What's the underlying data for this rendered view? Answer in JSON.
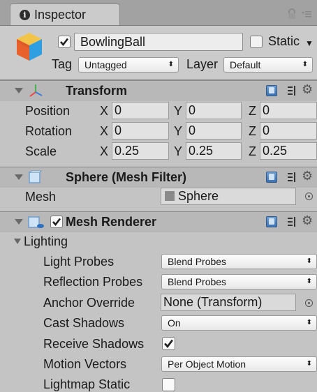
{
  "tab": {
    "title": "Inspector"
  },
  "header": {
    "object_name": "BowlingBall",
    "static_label": "Static",
    "tag_label": "Tag",
    "tag_value": "Untagged",
    "layer_label": "Layer",
    "layer_value": "Default"
  },
  "transform": {
    "title": "Transform",
    "rows": [
      {
        "label": "Position",
        "x": "0",
        "y": "0",
        "z": "0"
      },
      {
        "label": "Rotation",
        "x": "0",
        "y": "0",
        "z": "0"
      },
      {
        "label": "Scale",
        "x": "0.25",
        "y": "0.25",
        "z": "0.25"
      }
    ],
    "axis_x": "X",
    "axis_y": "Y",
    "axis_z": "Z"
  },
  "mesh_filter": {
    "title": "Sphere (Mesh Filter)",
    "mesh_label": "Mesh",
    "mesh_value": "Sphere"
  },
  "mesh_renderer": {
    "title": "Mesh Renderer",
    "lighting_label": "Lighting",
    "light_probes_label": "Light Probes",
    "light_probes_value": "Blend Probes",
    "reflection_probes_label": "Reflection Probes",
    "reflection_probes_value": "Blend Probes",
    "anchor_override_label": "Anchor Override",
    "anchor_override_value": "None (Transform)",
    "cast_shadows_label": "Cast Shadows",
    "cast_shadows_value": "On",
    "receive_shadows_label": "Receive Shadows",
    "receive_shadows_checked": true,
    "motion_vectors_label": "Motion Vectors",
    "motion_vectors_value": "Per Object Motion",
    "lightmap_static_label": "Lightmap Static",
    "lightmap_static_checked": false
  },
  "icons": {
    "tab": "info-icon",
    "lock": "lock-icon",
    "menu": "menu-icon",
    "object": "cube-icon",
    "transform": "transform-axes-icon",
    "mesh_filter": "mesh-filter-icon",
    "mesh_renderer": "mesh-renderer-icon",
    "help": "help-book-icon",
    "preset": "preset-icon",
    "gear": "gear-icon"
  },
  "colors": {
    "panel": "#c2c2c2",
    "header": "#cbcbcb",
    "component_header": "#b8b8b8",
    "checkmark": "#1f1f1f",
    "help_blue": "#3f72b2"
  }
}
